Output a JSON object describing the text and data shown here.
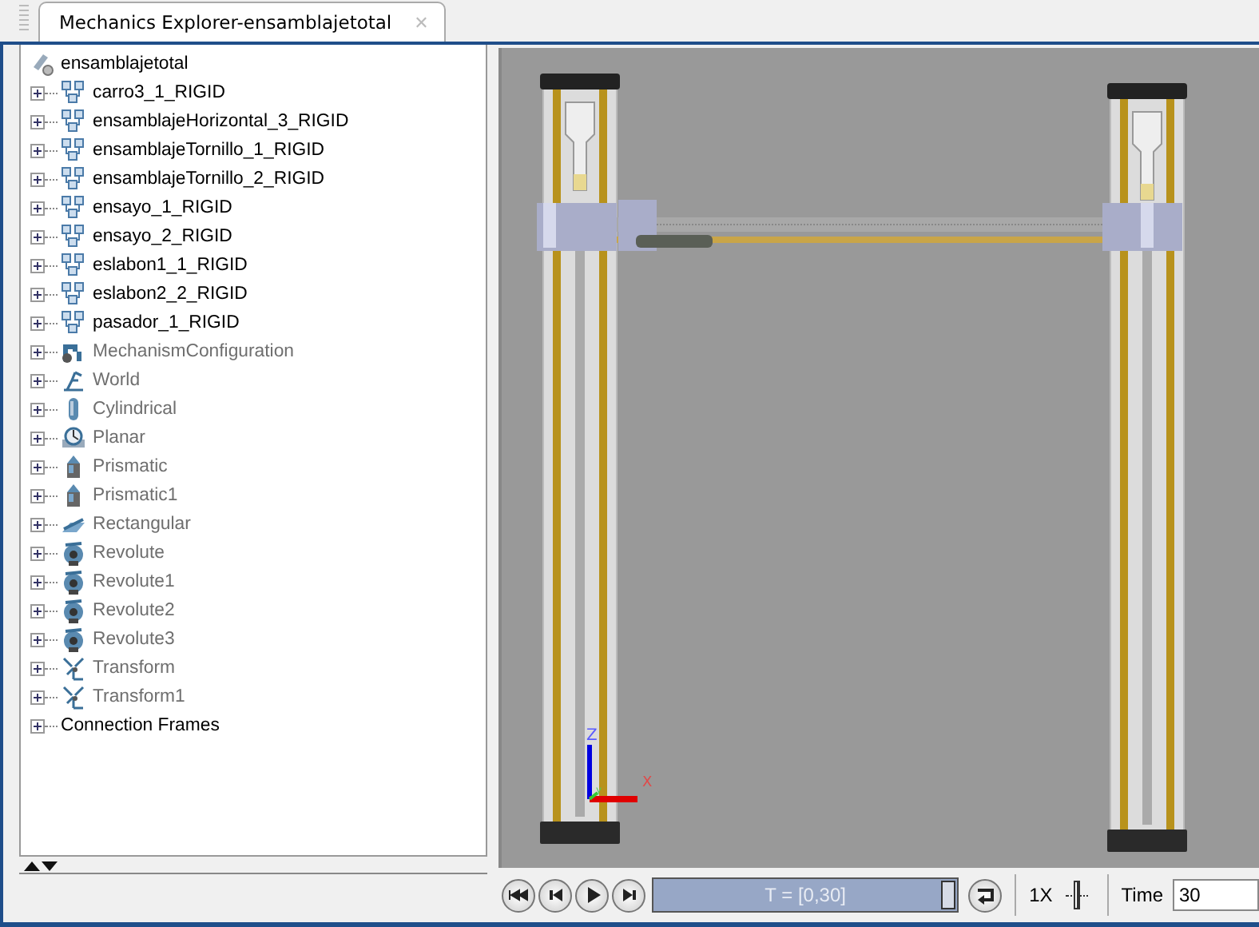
{
  "tab": {
    "title": "Mechanics Explorer-ensamblajetotal",
    "close": "✕",
    "selected": true
  },
  "tree": {
    "root": "ensamblajetotal",
    "items": [
      {
        "label": "carro3_1_RIGID",
        "kind": "body",
        "dimmed": false
      },
      {
        "label": "ensamblajeHorizontal_3_RIGID",
        "kind": "body",
        "dimmed": false
      },
      {
        "label": "ensamblajeTornillo_1_RIGID",
        "kind": "body",
        "dimmed": false
      },
      {
        "label": "ensamblajeTornillo_2_RIGID",
        "kind": "body",
        "dimmed": false
      },
      {
        "label": "ensayo_1_RIGID",
        "kind": "body",
        "dimmed": false
      },
      {
        "label": "ensayo_2_RIGID",
        "kind": "body",
        "dimmed": false
      },
      {
        "label": "eslabon1_1_RIGID",
        "kind": "body",
        "dimmed": false
      },
      {
        "label": "eslabon2_2_RIGID",
        "kind": "body",
        "dimmed": false
      },
      {
        "label": "pasador_1_RIGID",
        "kind": "body",
        "dimmed": false
      },
      {
        "label": "MechanismConfiguration",
        "kind": "config",
        "dimmed": true
      },
      {
        "label": "World",
        "kind": "world",
        "dimmed": true
      },
      {
        "label": "Cylindrical",
        "kind": "cylindrical",
        "dimmed": true
      },
      {
        "label": "Planar",
        "kind": "planar",
        "dimmed": true
      },
      {
        "label": "Prismatic",
        "kind": "prismatic",
        "dimmed": true
      },
      {
        "label": "Prismatic1",
        "kind": "prismatic",
        "dimmed": true
      },
      {
        "label": "Rectangular",
        "kind": "rectangular",
        "dimmed": true
      },
      {
        "label": "Revolute",
        "kind": "revolute",
        "dimmed": true
      },
      {
        "label": "Revolute1",
        "kind": "revolute",
        "dimmed": true
      },
      {
        "label": "Revolute2",
        "kind": "revolute",
        "dimmed": true
      },
      {
        "label": "Revolute3",
        "kind": "revolute",
        "dimmed": true
      },
      {
        "label": "Transform",
        "kind": "transform",
        "dimmed": true
      },
      {
        "label": "Transform1",
        "kind": "transform",
        "dimmed": true
      },
      {
        "label": "Connection Frames",
        "kind": "frames",
        "dimmed": false
      }
    ]
  },
  "viewport": {
    "axis_labels": {
      "z": "Z",
      "x": "X",
      "y": "y"
    }
  },
  "playback": {
    "buttons": [
      {
        "kind": "rewind"
      },
      {
        "kind": "step-back"
      },
      {
        "kind": "play"
      },
      {
        "kind": "step-forward"
      }
    ],
    "timeline": {
      "text": "T = [0,30]",
      "level": 1.0
    },
    "speed": {
      "label": "1X"
    },
    "time": {
      "label": "Time",
      "value": "30"
    }
  }
}
